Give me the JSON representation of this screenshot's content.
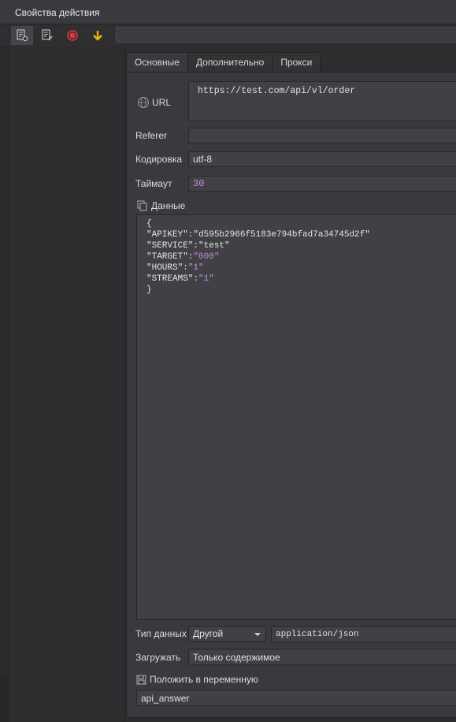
{
  "window": {
    "title": "Свойства действия"
  },
  "tabs": [
    {
      "label": "Основные"
    },
    {
      "label": "Дополнительно"
    },
    {
      "label": "Прокси"
    }
  ],
  "form": {
    "url_label": "URL",
    "url_value": "https://test.com/api/vl/order",
    "referer_label": "Referer",
    "referer_value": "",
    "encoding_label": "Кодировка",
    "encoding_value": "utf-8",
    "timeout_label": "Таймаут",
    "timeout_value": "30",
    "data_label": "Данные",
    "data_lines": [
      {
        "text": "{"
      },
      {
        "key": "\"APIKEY\"",
        "value": "\"d595b2966f5183e794bfad7a34745d2f\""
      },
      {
        "key": "\"SERVICE\"",
        "value": "\"test\""
      },
      {
        "key": "\"TARGET\"",
        "value": "\"000\""
      },
      {
        "key": "\"HOURS\"",
        "value": "\"1\""
      },
      {
        "key": "\"STREAMS\"",
        "value": "\"1\""
      },
      {
        "text": "}"
      }
    ],
    "datatype_label": "Тип данных",
    "datatype_value": "Другой",
    "content_type_value": "application/json",
    "load_label": "Загружать",
    "load_value": "Только содержимое",
    "save_var_label": "Положить в переменную",
    "save_var_value": "api_answer"
  },
  "icons": {
    "toolbar": [
      "document-settings-icon",
      "document-edit-icon",
      "record-icon",
      "arrow-down-icon"
    ],
    "colors": {
      "record": "#e03a3a",
      "arrow": "#f0b400"
    }
  }
}
